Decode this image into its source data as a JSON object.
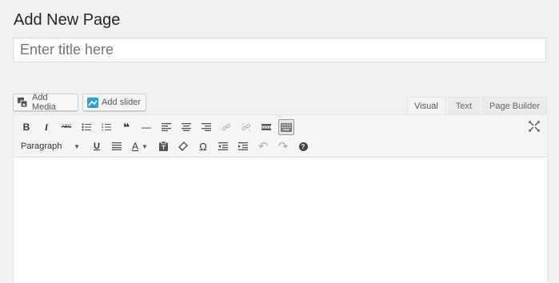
{
  "page": {
    "title": "Add New Page"
  },
  "title_field": {
    "placeholder": "Enter title here",
    "value": ""
  },
  "media_buttons": {
    "add_media": "Add Media",
    "add_slider": "Add slider"
  },
  "editor_tabs": [
    {
      "label": "Visual",
      "active": true
    },
    {
      "label": "Text",
      "active": false
    },
    {
      "label": "Page Builder",
      "active": false
    }
  ],
  "toolbar": {
    "row1": [
      {
        "name": "bold-icon",
        "glyph": "B"
      },
      {
        "name": "italic-icon",
        "glyph": "I"
      },
      {
        "name": "strikethrough-icon",
        "glyph": "ABC"
      },
      {
        "name": "bulleted-list-icon",
        "glyph": ""
      },
      {
        "name": "numbered-list-icon",
        "glyph": ""
      },
      {
        "name": "blockquote-icon",
        "glyph": "❝"
      },
      {
        "name": "horizontal-line-icon",
        "glyph": "—"
      },
      {
        "name": "align-left-icon",
        "glyph": ""
      },
      {
        "name": "align-center-icon",
        "glyph": ""
      },
      {
        "name": "align-right-icon",
        "glyph": ""
      },
      {
        "name": "insert-link-icon",
        "glyph": ""
      },
      {
        "name": "remove-link-icon",
        "glyph": ""
      },
      {
        "name": "read-more-icon",
        "glyph": ""
      },
      {
        "name": "toolbar-toggle-icon",
        "glyph": ""
      }
    ],
    "format_select": "Paragraph",
    "row2": [
      {
        "name": "underline-icon",
        "glyph": "U"
      },
      {
        "name": "justify-icon",
        "glyph": ""
      },
      {
        "name": "text-color-icon",
        "glyph": "A"
      },
      {
        "name": "paste-as-text-icon",
        "glyph": ""
      },
      {
        "name": "clear-formatting-icon",
        "glyph": ""
      },
      {
        "name": "special-character-icon",
        "glyph": "Ω"
      },
      {
        "name": "decrease-indent-icon",
        "glyph": ""
      },
      {
        "name": "increase-indent-icon",
        "glyph": ""
      },
      {
        "name": "undo-icon",
        "glyph": "↶"
      },
      {
        "name": "redo-icon",
        "glyph": "↷"
      },
      {
        "name": "help-icon",
        "glyph": "?"
      }
    ],
    "expand_icon": "fullscreen-icon"
  },
  "colors": {
    "background": "#f1f1f1",
    "slider_icon": "#2ea2cc",
    "text": "#23282d"
  }
}
